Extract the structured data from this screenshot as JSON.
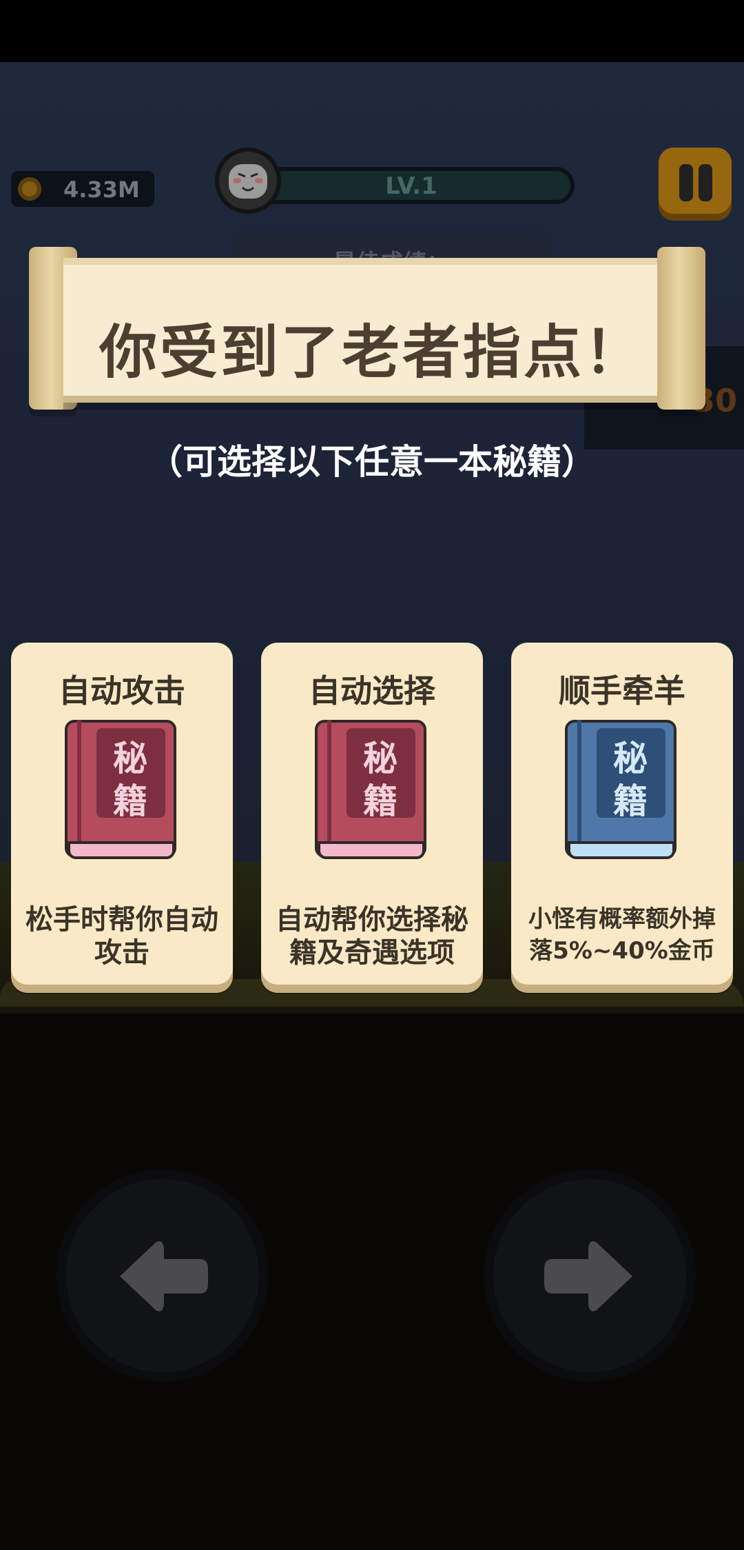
{
  "hud": {
    "coins": "4.33M",
    "level": "LV.1",
    "level_progress": 0.03,
    "best_label": "最佳成绩：",
    "side_value": "30",
    "icons": [
      "coin-icon",
      "avatar-icon",
      "pause-icon"
    ]
  },
  "banner": {
    "title": "你受到了老者指点！",
    "subtitle": "（可选择以下任意一本秘籍）"
  },
  "cards": [
    {
      "title": "自动攻击",
      "book_top": "秘",
      "book_bottom": "籍",
      "book_color": "red",
      "description": "松手时帮你自动攻击"
    },
    {
      "title": "自动选择",
      "book_top": "秘",
      "book_bottom": "籍",
      "book_color": "red",
      "description": "自动帮你选择秘籍及奇遇选项"
    },
    {
      "title": "顺手牵羊",
      "book_top": "秘",
      "book_bottom": "籍",
      "book_color": "blue",
      "description": "小怪有概率额外掉落5%~40%金币"
    }
  ],
  "controls": {
    "left": "left-arrow-icon",
    "right": "right-arrow-icon"
  },
  "colors": {
    "card_bg": "#f9e9c6",
    "book_red": "#b44c5e",
    "book_blue": "#4f78a8",
    "pause": "#c98a14"
  }
}
